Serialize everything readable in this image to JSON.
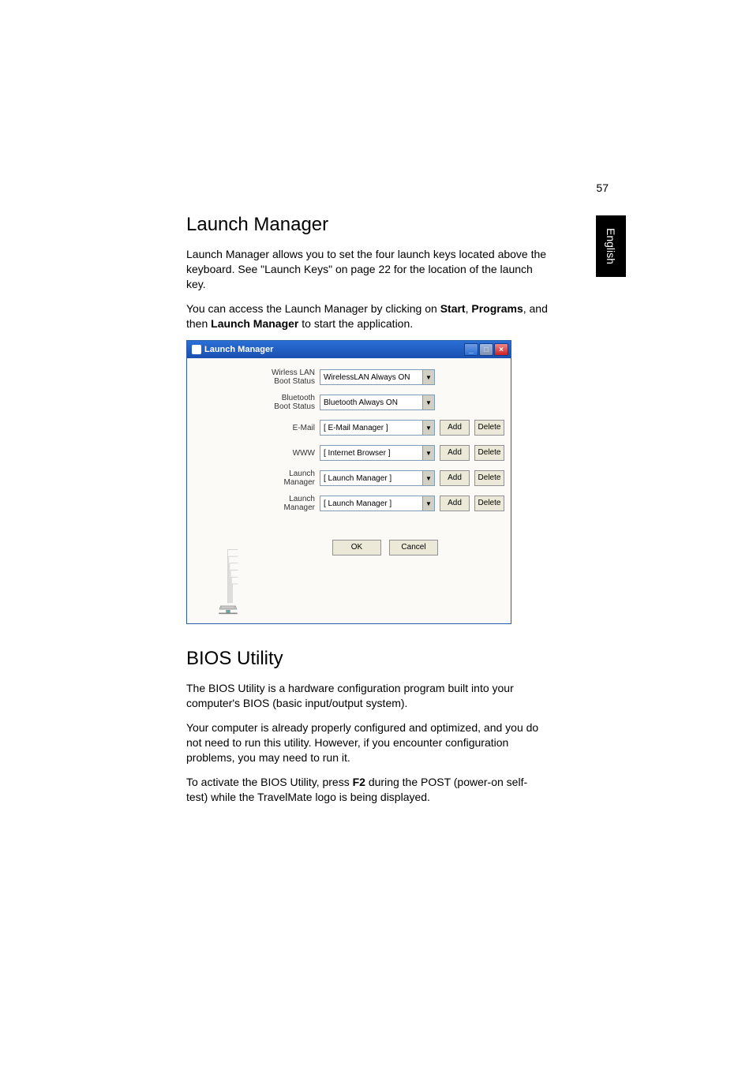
{
  "page_number": "57",
  "side_tab": "English",
  "section1": {
    "title": "Launch Manager",
    "p1": "Launch Manager allows you to set the four launch keys located above the keyboard. See \"Launch Keys\" on page 22 for the location of the launch key.",
    "p2a": "You can access the Launch Manager by clicking on ",
    "p2b": "Start",
    "p2c": ", ",
    "p2d": "Programs",
    "p2e": ", and then ",
    "p2f": "Launch Manager",
    "p2g": " to start the application."
  },
  "launch_manager": {
    "title": "Launch Manager",
    "rows": [
      {
        "label": "Wirless LAN Boot Status",
        "value": "WirelessLAN Always ON",
        "has_buttons": false
      },
      {
        "label": "Bluetooth Boot Status",
        "value": "Bluetooth Always ON",
        "has_buttons": false
      },
      {
        "label": "E-Mail",
        "value": "[ E-Mail Manager ]",
        "has_buttons": true
      },
      {
        "label": "WWW",
        "value": "[ Internet Browser ]",
        "has_buttons": true
      },
      {
        "label": "Launch Manager",
        "value": "[ Launch Manager ]",
        "has_buttons": true
      },
      {
        "label": "Launch Manager",
        "value": "[ Launch Manager ]",
        "has_buttons": true
      }
    ],
    "add_label": "Add",
    "delete_label": "Delete",
    "ok_label": "OK",
    "cancel_label": "Cancel"
  },
  "section2": {
    "title": "BIOS Utility",
    "p1": "The BIOS Utility is a hardware configuration program built into your computer's BIOS (basic input/output system).",
    "p2": "Your computer is already properly configured and optimized, and you do not need to run this utility. However, if you encounter configuration problems, you may need to run it.",
    "p3a": "To activate the BIOS Utility, press ",
    "p3b": "F2",
    "p3c": " during the POST (power-on self-test) while the TravelMate logo is being displayed."
  }
}
